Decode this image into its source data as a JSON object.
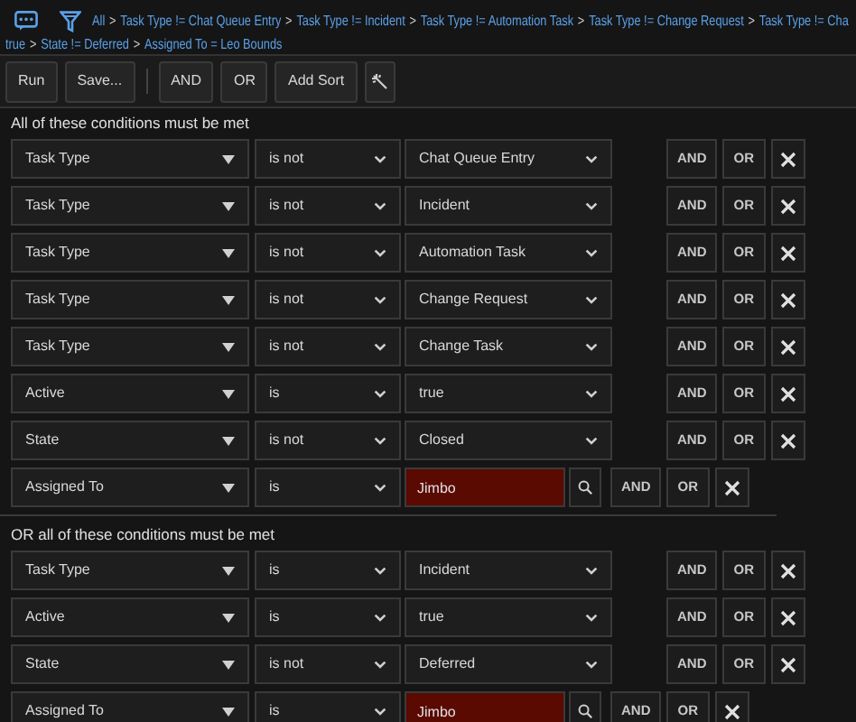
{
  "breadcrumb": {
    "separator": ">",
    "lines": [
      [
        "All",
        "Task Type != Chat Queue Entry",
        "Task Type != Incident",
        "Task Type != Automation Task",
        "Task Type != Change Request",
        "Task Type != Cha"
      ],
      [
        "true",
        "State != Deferred",
        "Assigned To = Leo Bounds"
      ]
    ]
  },
  "toolbar": {
    "primary": [
      "Run",
      "Save..."
    ],
    "secondary": [
      "AND",
      "OR",
      "Add Sort"
    ]
  },
  "groups": [
    {
      "heading": "All of these conditions must be met",
      "conditions": [
        {
          "kind": "select",
          "field": "Task Type",
          "operator": "is not",
          "value": "Chat Queue Entry",
          "and_label": "AND",
          "or_label": "OR"
        },
        {
          "kind": "select",
          "field": "Task Type",
          "operator": "is not",
          "value": "Incident",
          "and_label": "AND",
          "or_label": "OR"
        },
        {
          "kind": "select",
          "field": "Task Type",
          "operator": "is not",
          "value": "Automation Task",
          "and_label": "AND",
          "or_label": "OR"
        },
        {
          "kind": "select",
          "field": "Task Type",
          "operator": "is not",
          "value": "Change Request",
          "and_label": "AND",
          "or_label": "OR"
        },
        {
          "kind": "select",
          "field": "Task Type",
          "operator": "is not",
          "value": "Change Task",
          "and_label": "AND",
          "or_label": "OR"
        },
        {
          "kind": "select",
          "field": "Active",
          "operator": "is",
          "value": "true",
          "and_label": "AND",
          "or_label": "OR"
        },
        {
          "kind": "select",
          "field": "State",
          "operator": "is not",
          "value": "Closed",
          "and_label": "AND",
          "or_label": "OR"
        },
        {
          "kind": "lookup",
          "field": "Assigned To",
          "operator": "is",
          "value": "Jimbo",
          "and_label": "AND",
          "or_label": "OR"
        }
      ]
    },
    {
      "heading": "OR all of these conditions must be met",
      "conditions": [
        {
          "kind": "select",
          "field": "Task Type",
          "operator": "is",
          "value": "Incident",
          "and_label": "AND",
          "or_label": "OR"
        },
        {
          "kind": "select",
          "field": "Active",
          "operator": "is",
          "value": "true",
          "and_label": "AND",
          "or_label": "OR"
        },
        {
          "kind": "select",
          "field": "State",
          "operator": "is not",
          "value": "Deferred",
          "and_label": "AND",
          "or_label": "OR"
        },
        {
          "kind": "lookup",
          "field": "Assigned To",
          "operator": "is",
          "value": "Jimbo",
          "and_label": "AND",
          "or_label": "OR"
        }
      ]
    }
  ]
}
